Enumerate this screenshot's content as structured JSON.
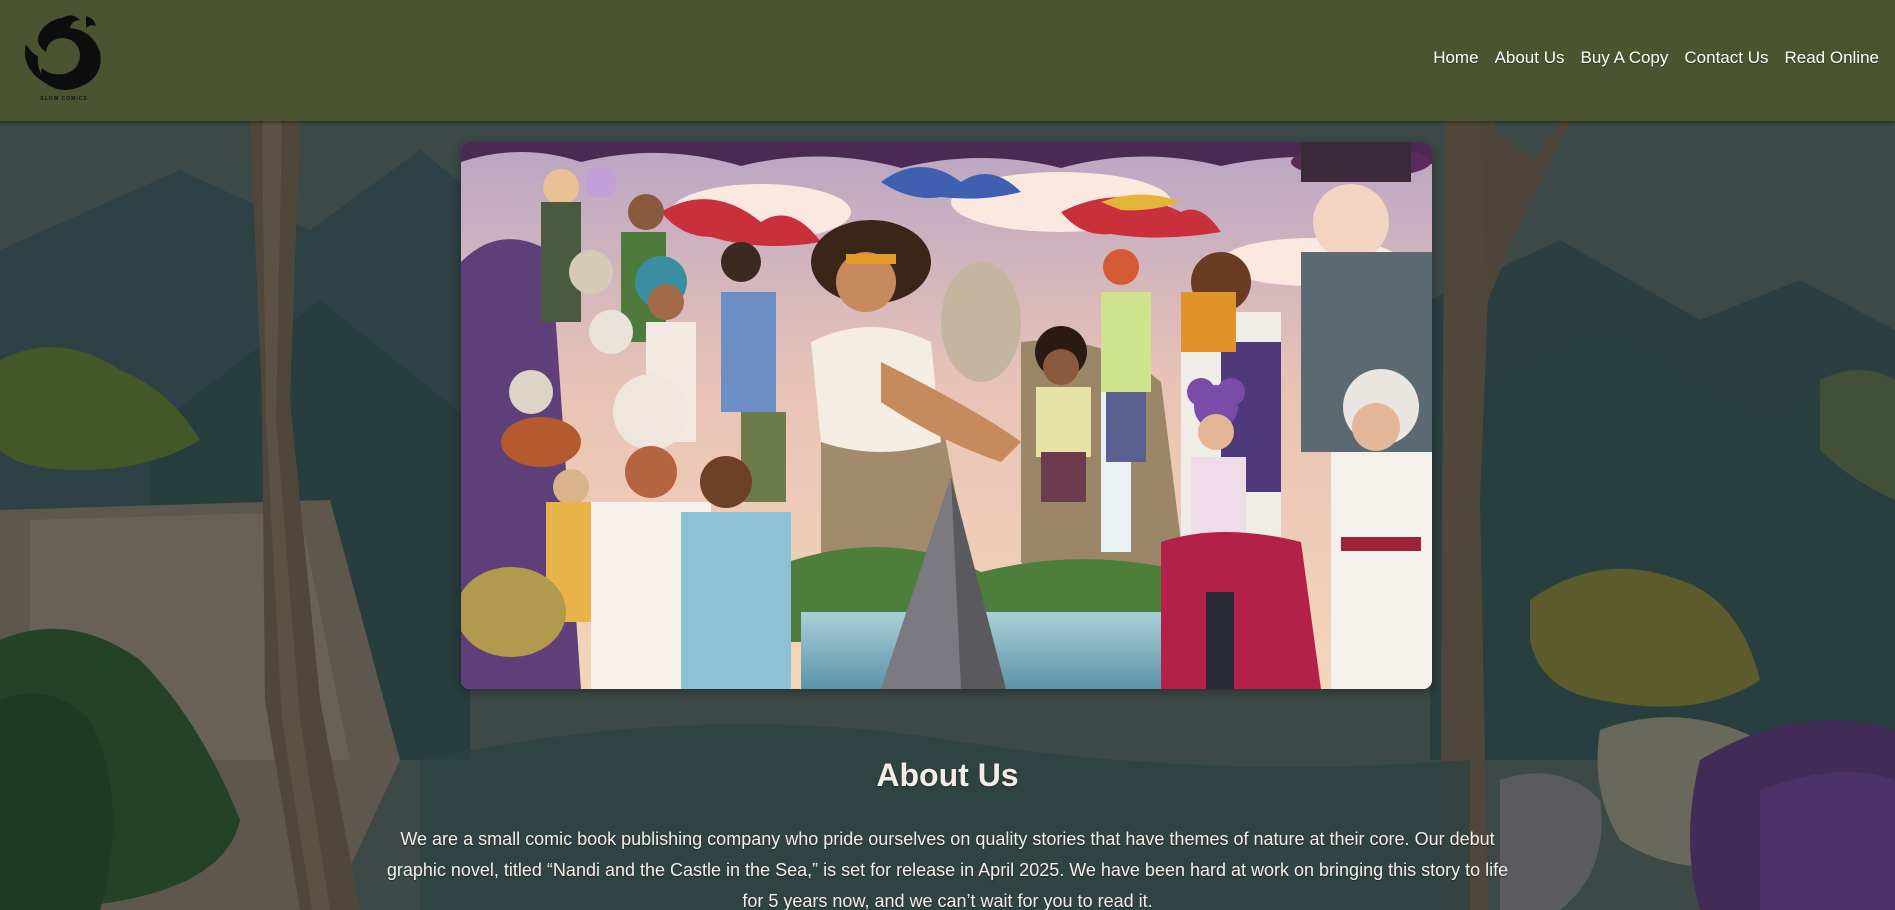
{
  "brand": {
    "logo_text": "SLOW COMICS"
  },
  "nav": {
    "items": [
      {
        "label": "Home"
      },
      {
        "label": "About Us"
      },
      {
        "label": "Buy A Copy"
      },
      {
        "label": "Contact Us"
      },
      {
        "label": "Read Online"
      }
    ]
  },
  "about": {
    "title": "About Us",
    "body": "We are a small comic book publishing company who pride ourselves on quality stories that have themes of nature at their core. Our debut graphic novel, titled “Nandi and the Castle in the Sea,” is set for release in April 2025. We have been hard at work on bringing this story to life for 5 years now, and we can’t wait for you to read it."
  },
  "colors": {
    "header_bg": "#4b5431",
    "nav_text": "#ffffff",
    "text": "#f4eee6"
  }
}
